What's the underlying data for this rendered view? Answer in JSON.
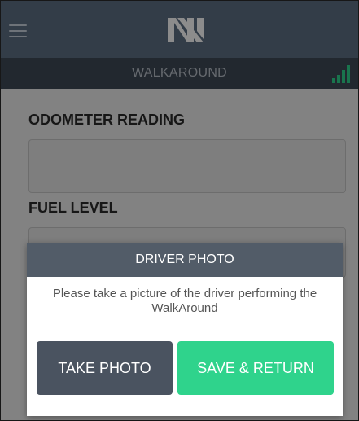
{
  "header": {
    "menu_icon": "hamburger-menu-icon",
    "logo_icon": "brand-n-logo-icon",
    "title": "WALKAROUND",
    "signal_icon": "signal-strength-icon",
    "colors": {
      "bar": "#5e6f84",
      "subbar": "#3e4956",
      "signal": "#2fd38c"
    }
  },
  "form": {
    "odometer_label": "ODOMETER READING",
    "fuel_label": "FUEL LEVEL"
  },
  "modal": {
    "title": "DRIVER PHOTO",
    "message": "Please take a picture of the driver performing the WalkAround",
    "take_photo_label": "TAKE PHOTO",
    "save_return_label": "SAVE & RETURN",
    "colors": {
      "take_photo": "#4a5360",
      "save_return": "#2fd38c"
    }
  }
}
